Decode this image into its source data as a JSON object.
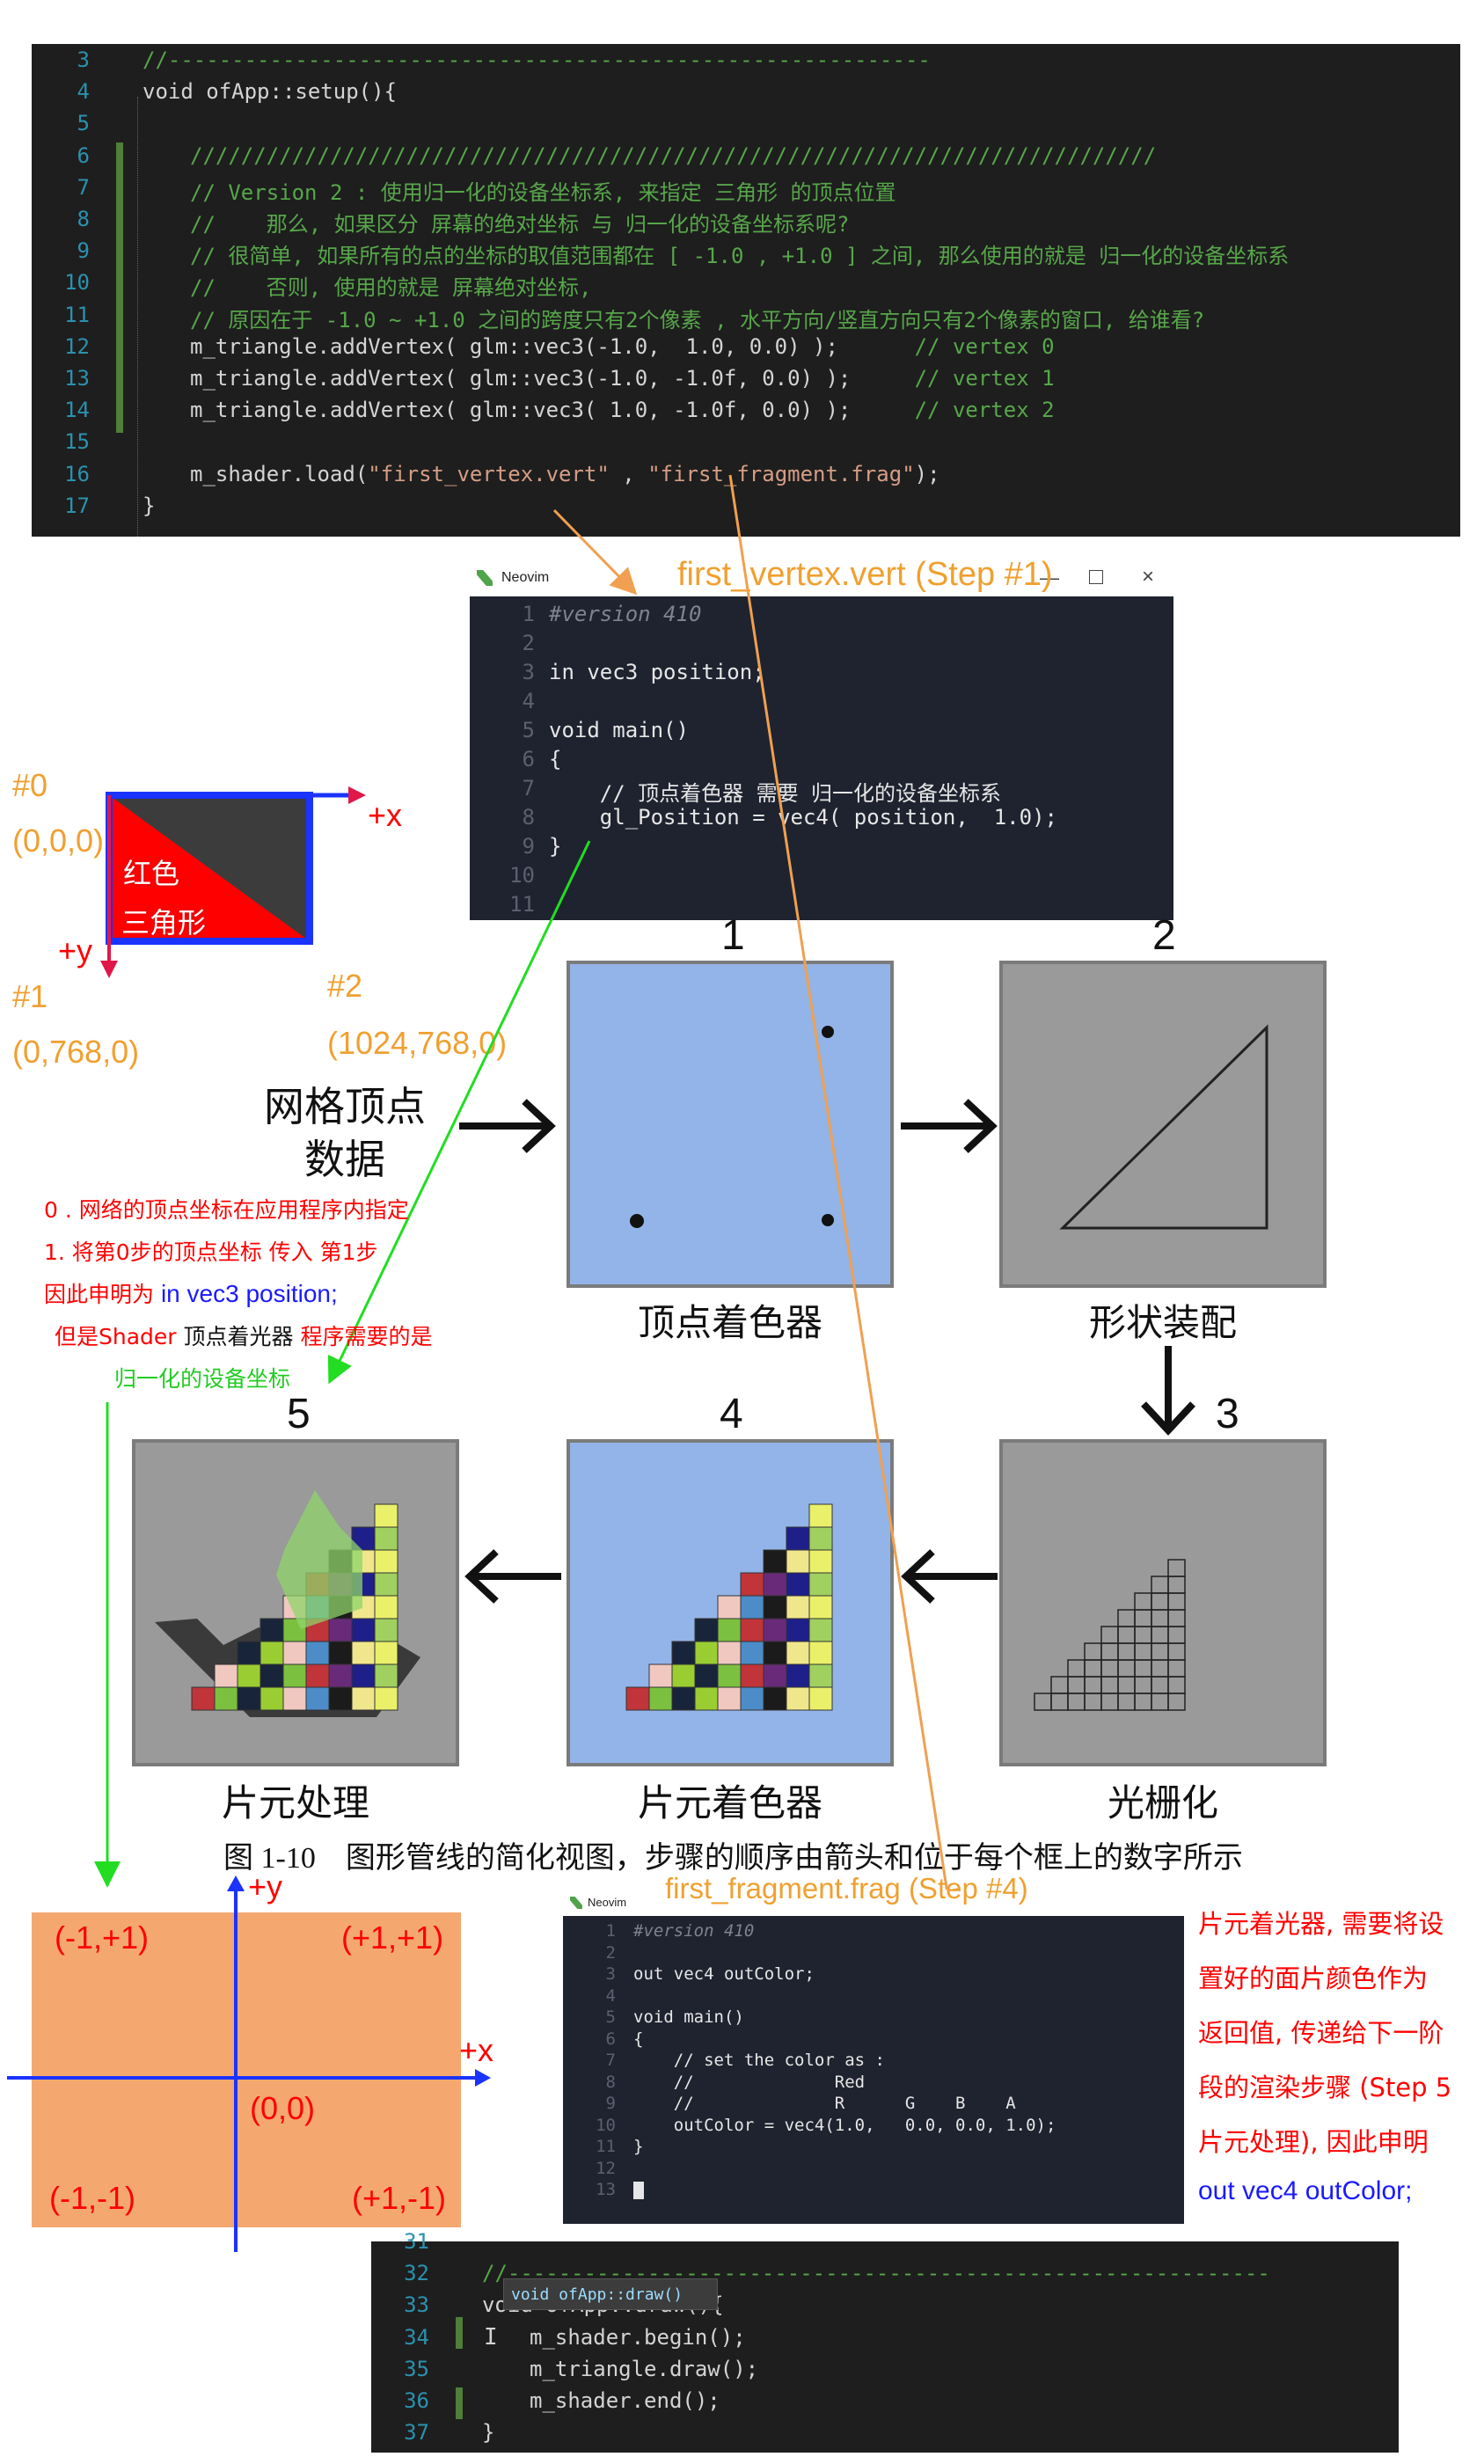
{
  "top_code": {
    "lines": [
      {
        "n": "3",
        "text": "//------------------------------------------------------------"
      },
      {
        "n": "4",
        "text": "void ofApp::setup(){"
      },
      {
        "n": "5",
        "text": ""
      },
      {
        "n": "6",
        "text": "////////////////////////////////////////////////////////////////////////////"
      },
      {
        "n": "7",
        "text": "// Version 2 : 使用归一化的设备坐标系, 来指定 三角形 的顶点位置"
      },
      {
        "n": "8",
        "text": "//    那么, 如果区分 屏幕的绝对坐标 与 归一化的设备坐标系呢?"
      },
      {
        "n": "9",
        "text": "// 很简单, 如果所有的点的坐标的取值范围都在 [ -1.0 , +1.0 ] 之间, 那么使用的就是 归一化的设备坐标系"
      },
      {
        "n": "10",
        "text": "//    否则, 使用的就是 屏幕绝对坐标,"
      },
      {
        "n": "11",
        "text": "// 原因在于 -1.0 ~ +1.0 之间的跨度只有2个像素 , 水平方向/竖直方向只有2个像素的窗口, 给谁看?"
      },
      {
        "n": "12",
        "text": "m_triangle.addVertex( glm::vec3(-1.0,  1.0, 0.0) );      // vertex 0"
      },
      {
        "n": "13",
        "text": "m_triangle.addVertex( glm::vec3(-1.0, -1.0f, 0.0) );     // vertex 1"
      },
      {
        "n": "14",
        "text": "m_triangle.addVertex( glm::vec3( 1.0, -1.0f, 0.0) );     // vertex 2"
      },
      {
        "n": "15",
        "text": ""
      },
      {
        "n": "16",
        "text": "m_shader.load(\"first_vertex.vert\" , \"first_fragment.frag\");"
      },
      {
        "n": "17",
        "text": "}"
      }
    ]
  },
  "vert_window": {
    "app": "Neovim",
    "title": "first_vertex.vert (Step #1)",
    "lines": [
      {
        "n": "1",
        "text": "#version 410"
      },
      {
        "n": "2",
        "text": ""
      },
      {
        "n": "3",
        "text": "in vec3 position;"
      },
      {
        "n": "4",
        "text": ""
      },
      {
        "n": "5",
        "text": "void main()"
      },
      {
        "n": "6",
        "text": "{"
      },
      {
        "n": "7",
        "text": "    // 顶点着色器 需要 归一化的设备坐标系"
      },
      {
        "n": "8",
        "text": "    gl_Position = vec4( position,  1.0);"
      },
      {
        "n": "9",
        "text": "}"
      },
      {
        "n": "10",
        "text": ""
      },
      {
        "n": "11",
        "text": ""
      }
    ]
  },
  "screen_coords": {
    "p0_label": "#0",
    "p0_coord": "(0,0,0)",
    "p1_label": "#1",
    "p1_coord": "(0,768,0)",
    "p2_label": "#2",
    "p2_coord": "(1024,768,0)",
    "x_axis": "+x",
    "y_axis": "+y",
    "tri_label_1": "红色",
    "tri_label_2": "三角形"
  },
  "pipeline": {
    "input_label_1": "网格顶点",
    "input_label_2": "数据",
    "stages": [
      {
        "num": "1",
        "caption": "顶点着色器"
      },
      {
        "num": "2",
        "caption": "形状装配"
      },
      {
        "num": "3",
        "caption": "光栅化"
      },
      {
        "num": "4",
        "caption": "片元着色器"
      },
      {
        "num": "5",
        "caption": "片元处理"
      }
    ],
    "figure_caption": "图 1-10    图形管线的简化视图，步骤的顺序由箭头和位于每个框上的数字所示"
  },
  "notes_left": {
    "line1": "0 . 网络的顶点坐标在应用程序内指定",
    "line2": "1. 将第0步的顶点坐标 传入 第1步",
    "line3a": "因此申明为 ",
    "line3b": "in vec3 position;",
    "line4a": "但是Shader ",
    "line4b": "顶点着光器",
    "line4c": " 程序需要的是",
    "line5": "归一化的设备坐标"
  },
  "ndc": {
    "tl": "(-1,+1)",
    "tr": "(+1,+1)",
    "bl": "(-1,-1)",
    "br": "(+1,-1)",
    "origin": "(0,0)",
    "x_axis": "+x",
    "y_axis": "+y"
  },
  "frag_window": {
    "app": "Neovim",
    "title": "first_fragment.frag (Step #4)",
    "lines": [
      {
        "n": "1",
        "text": "#version 410"
      },
      {
        "n": "2",
        "text": ""
      },
      {
        "n": "3",
        "text": "out vec4 outColor;"
      },
      {
        "n": "4",
        "text": ""
      },
      {
        "n": "5",
        "text": "void main()"
      },
      {
        "n": "6",
        "text": "{"
      },
      {
        "n": "7",
        "text": "    // set the color as :"
      },
      {
        "n": "8",
        "text": "    //              Red"
      },
      {
        "n": "9",
        "text": "    //              R      G    B    A"
      },
      {
        "n": "10",
        "text": "    outColor = vec4(1.0,   0.0, 0.0, 1.0);"
      },
      {
        "n": "11",
        "text": "}"
      },
      {
        "n": "12",
        "text": ""
      },
      {
        "n": "13",
        "text": ""
      }
    ]
  },
  "notes_right": {
    "line1": "片元着光器, 需要将设",
    "line2": "置好的面片颜色作为",
    "line3": "返回值, 传递给下一阶",
    "line4": "段的渲染步骤 (Step 5",
    "line5": "片元处理), 因此申明",
    "line6": "out vec4 outColor;"
  },
  "bottom_code": {
    "tooltip": "void ofApp::draw()",
    "lines": [
      {
        "n": "31",
        "text": ""
      },
      {
        "n": "32",
        "text": "//------------------------------------------------------------"
      },
      {
        "n": "33",
        "text": "void ofApp::draw(){"
      },
      {
        "n": "34",
        "text": "m_shader.begin();"
      },
      {
        "n": "35",
        "text": "m_triangle.draw();"
      },
      {
        "n": "36",
        "text": "m_shader.end();"
      },
      {
        "n": "37",
        "text": "}"
      }
    ]
  },
  "colors": {
    "code_bg": "#1e1e1e",
    "nvim_bg": "#1f2330",
    "ndc_fill": "#f4a870",
    "orange_arrow": "#f0a050",
    "green_arrow": "#22dd22"
  }
}
